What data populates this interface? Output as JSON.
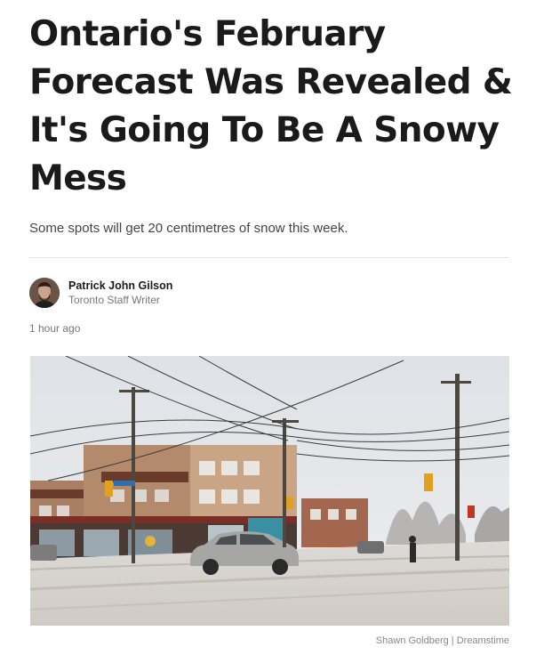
{
  "article": {
    "headline": "Ontario's February Forecast Was Revealed & It's Going To Be A Snowy Mess",
    "subtitle": "Some spots will get 20 centimetres of snow this week.",
    "author": {
      "name": "Patrick John Gilson",
      "role": "Toronto Staff Writer"
    },
    "timestamp": "1 hour ago",
    "photo": {
      "credit": "Shawn Goldberg | Dreamstime"
    }
  }
}
